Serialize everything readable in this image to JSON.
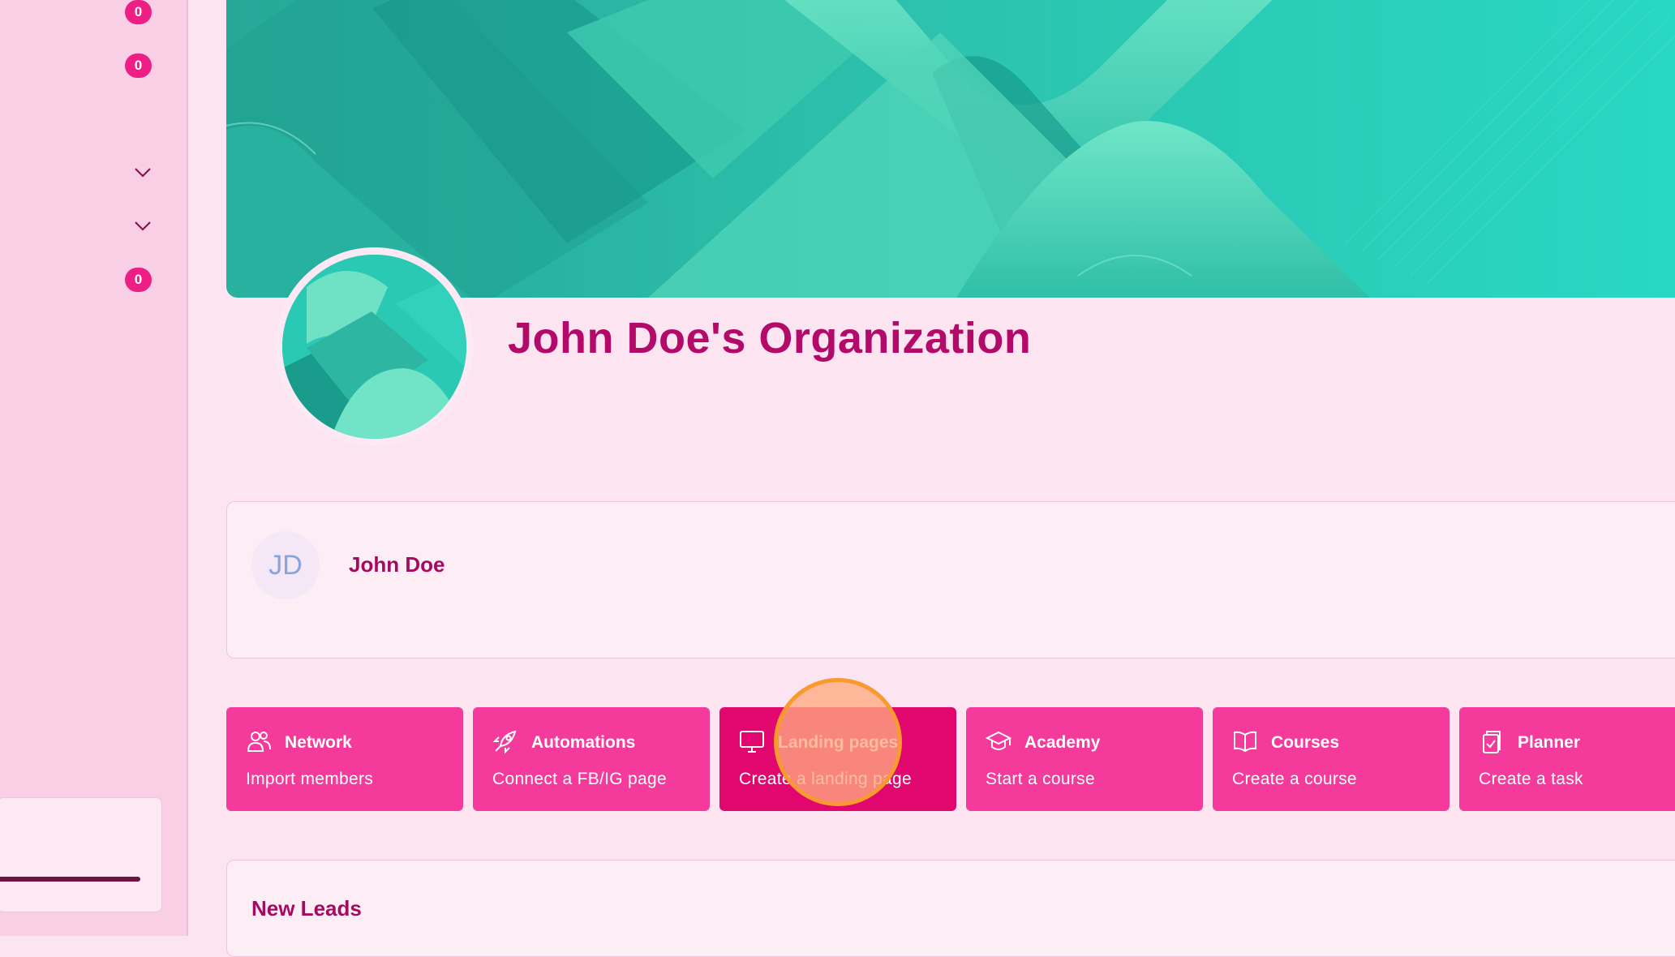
{
  "sidebar": {
    "badges": [
      "0",
      "0",
      "0"
    ]
  },
  "organization": {
    "title": "John Doe's Organization"
  },
  "user": {
    "initials": "JD",
    "name": "John Doe"
  },
  "tiles": [
    {
      "title": "Network",
      "subtitle": "Import members",
      "icon": "users-icon"
    },
    {
      "title": "Automations",
      "subtitle": "Connect a FB/IG page",
      "icon": "rocket-icon"
    },
    {
      "title": "Landing pages",
      "subtitle": "Create a landing page",
      "icon": "monitor-icon"
    },
    {
      "title": "Academy",
      "subtitle": "Start a course",
      "icon": "graduation-cap-icon"
    },
    {
      "title": "Courses",
      "subtitle": "Create a course",
      "icon": "book-icon"
    },
    {
      "title": "Planner",
      "subtitle": "Create a task",
      "icon": "clipboard-icon"
    }
  ],
  "leads": {
    "title": "New Leads"
  },
  "colors": {
    "accent": "#f43a9a",
    "accent_active": "#e2066f",
    "title": "#b30a6a",
    "background": "#fce4f1",
    "sidebar": "#f9cfe6"
  }
}
